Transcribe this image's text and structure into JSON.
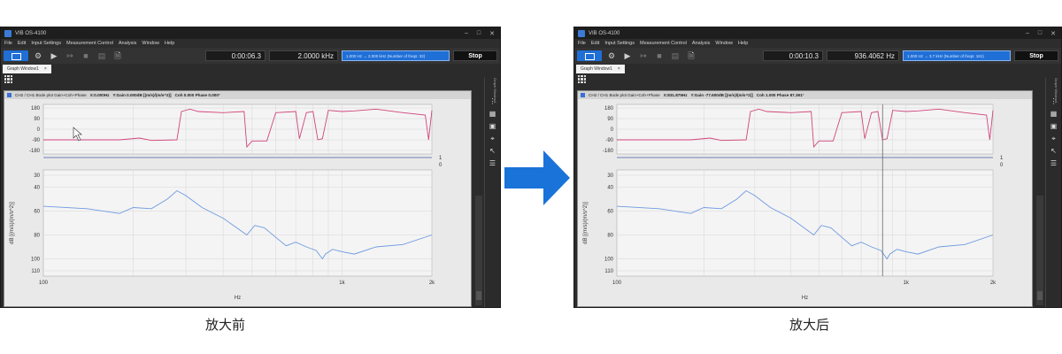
{
  "left_window": {
    "title": "VIB OS-4100",
    "menu": [
      "File",
      "Edit",
      "Input Settings",
      "Measurement Control",
      "Analysis",
      "Window",
      "Help"
    ],
    "elapsed": "0:00:06.3",
    "frequency": "2.0000 kHz",
    "range_text": "1.000 Hz → 2.000 kHz (Number of freqs: 32)",
    "stop_label": "Stop",
    "tab_label": "Graph Window1",
    "tab_close": "×",
    "side_label": "Graph Window1",
    "plot_header": {
      "series": "CH2 / CH1  Bode plot  Gain+Coh+Phase",
      "x": "X:0.000Hz",
      "y": "Y:Gain 0.000dB [(m/s)/(m/s^2)]",
      "coh": "Coh 0.000  Phase 0.000°"
    },
    "phase_ticks": [
      "180",
      "90",
      "0",
      "-90",
      "-180"
    ],
    "coh_ticks": [
      "1",
      "0"
    ],
    "gain_ticks": [
      "30",
      "40",
      "60",
      "80",
      "100",
      "110"
    ],
    "x_ticks": [
      "100",
      "1k",
      "2k"
    ],
    "x_label": "Hz",
    "y_label": "dB [(m/s)/(m/s^2)]"
  },
  "right_window": {
    "title": "VIB OS-4100",
    "menu": [
      "File",
      "Edit",
      "Input Settings",
      "Measurement Control",
      "Analysis",
      "Window",
      "Help"
    ],
    "elapsed": "0:00:10.3",
    "frequency": "936.4062 Hz",
    "range_text": "1.000 Hz → 3.7 kHz (Number of freqs: 161)",
    "stop_label": "Stop",
    "tab_label": "Graph Window1",
    "tab_close": "×",
    "side_label": "Graph Window1",
    "plot_header": {
      "series": "CH2 / CH1  Bode plot  Gain+Coh+Phase",
      "x": "X:831.875Hz",
      "y": "Y:Gain -77.600dB [(m/s)/(m/s^2)]",
      "coh": "Coh 1.000  Phase 87.391°"
    },
    "phase_ticks": [
      "180",
      "90",
      "0",
      "-90",
      "-180"
    ],
    "coh_ticks": [
      "1",
      "0"
    ],
    "gain_ticks": [
      "30",
      "40",
      "60",
      "80",
      "100",
      "110"
    ],
    "x_ticks": [
      "100",
      "1k",
      "2k"
    ],
    "x_label": "Hz",
    "y_label": "dB [(m/s)/(m/s^2)]"
  },
  "captions": {
    "before": "放大前",
    "after": "放大后"
  },
  "colors": {
    "phase": "#d0457a",
    "gain": "#6f9ae0",
    "coherence": "#4c5ea8",
    "arrow": "#1a73d9",
    "accent": "#1f6fd6"
  },
  "icons": {
    "toolbar": [
      "play-icon",
      "step-icon",
      "stop-square-icon",
      "record-icon",
      "save-icon"
    ],
    "side": [
      "menu-dots-icon",
      "table-icon",
      "image-icon",
      "cursor-icon",
      "marker-icon",
      "list-icon"
    ]
  }
}
